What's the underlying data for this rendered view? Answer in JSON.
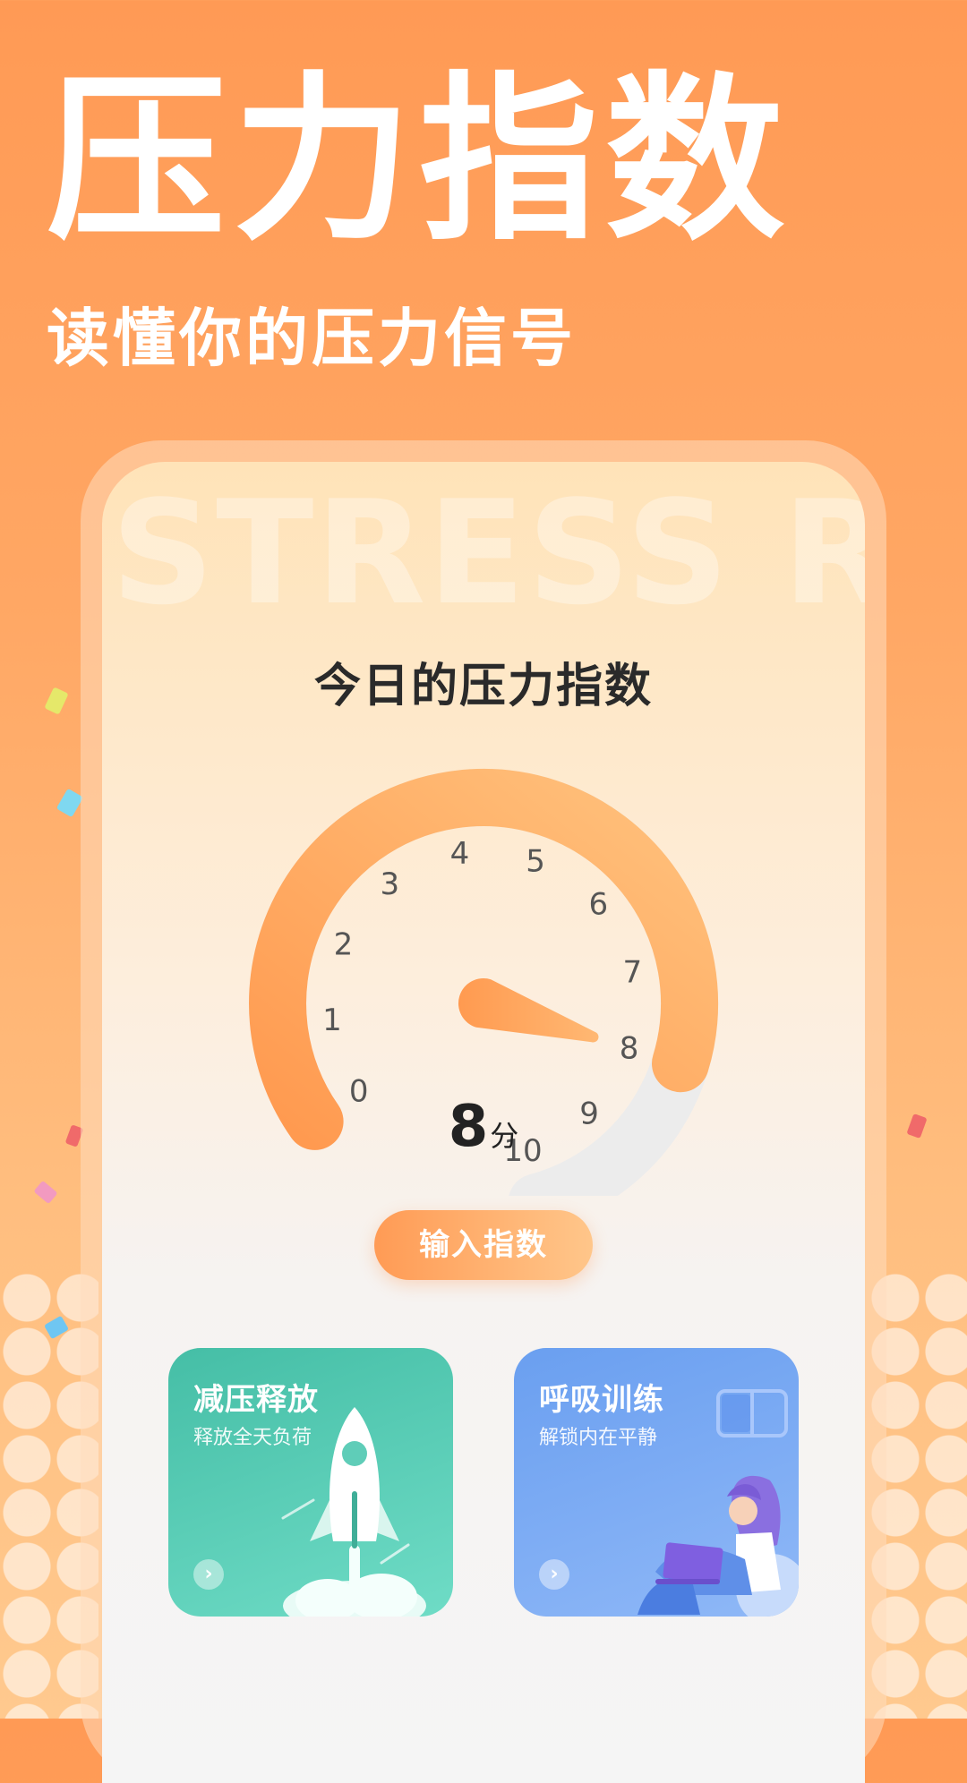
{
  "hero": {
    "title": "压力指数",
    "subtitle": "读懂你的压力信号"
  },
  "watermark": "STRESS RE",
  "card": {
    "heading": "今日的压力指数"
  },
  "gauge": {
    "min": 0,
    "max": 10,
    "value": 8,
    "tick_labels": [
      "0",
      "1",
      "2",
      "3",
      "4",
      "5",
      "6",
      "7",
      "8",
      "9",
      "10"
    ],
    "score_value": "8",
    "score_unit": "分",
    "colors": {
      "fill_start": "#ff9a50",
      "fill_end": "#ffc17c",
      "track": "#ececec",
      "needle": "#ff9f5a"
    }
  },
  "cta": {
    "label": "输入指数"
  },
  "features": [
    {
      "title": "减压释放",
      "subtitle": "释放全天负荷",
      "icon": "rocket-icon",
      "color": "#4cc3ab"
    },
    {
      "title": "呼吸训练",
      "subtitle": "解锁内在平静",
      "icon": "person-laptop-illustration",
      "color": "#72a4f2"
    }
  ],
  "colors": {
    "background_top": "#ff9a55",
    "background_bottom": "#ffc98e",
    "accent": "#ff9b55"
  }
}
